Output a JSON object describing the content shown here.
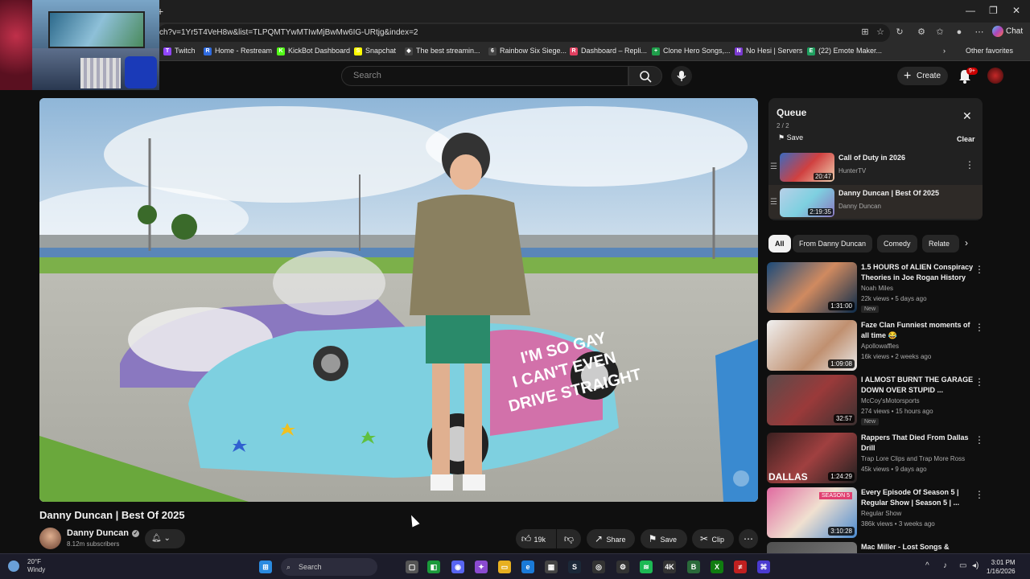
{
  "browser": {
    "url": "ch?v=1Yr5T4VeH8w&list=TLPQMTYwMTIwMjBwMw6IG-URtjg&index=2",
    "chat_label": "Chat",
    "bookmarks": [
      {
        "label": "Twitch",
        "color": "#9146ff",
        "glyph": "T"
      },
      {
        "label": "Home - Restream",
        "color": "#2f6be0",
        "glyph": "R"
      },
      {
        "label": "KickBot Dashboard",
        "color": "#53fc18",
        "glyph": "K"
      },
      {
        "label": "Snapchat",
        "color": "#fffc00",
        "glyph": "S"
      },
      {
        "label": "The best streamin...",
        "color": "#444",
        "glyph": "◆"
      },
      {
        "label": "Rainbow Six Siege...",
        "color": "#444",
        "glyph": "6"
      },
      {
        "label": "Dashboard – Repli...",
        "color": "#e04060",
        "glyph": "R"
      },
      {
        "label": "Clone Hero Songs,...",
        "color": "#1e9e4a",
        "glyph": "+"
      },
      {
        "label": "No Hesi | Servers",
        "color": "#7a3ad0",
        "glyph": "N"
      },
      {
        "label": "(22) Emote Maker...",
        "color": "#20a060",
        "glyph": "E"
      }
    ],
    "other_favorites": "Other favorites"
  },
  "topbar": {
    "search_placeholder": "Search",
    "create_label": "Create",
    "notif_badge": "9+"
  },
  "video": {
    "title": "Danny Duncan | Best Of 2025",
    "channel": "Danny Duncan",
    "subscribers": "8.12m subscribers",
    "likes": "19k",
    "share_label": "Share",
    "save_label": "Save",
    "clip_label": "Clip"
  },
  "queue": {
    "title": "Queue",
    "count": "2 / 2",
    "save_label": "Save",
    "clear_label": "Clear",
    "items": [
      {
        "title": "Call of Duty in 2026",
        "channel": "HunterTV",
        "duration": "20:47"
      },
      {
        "title": "Danny Duncan | Best Of 2025",
        "channel": "Danny Duncan",
        "duration": "2:19:35"
      }
    ]
  },
  "chips": [
    "All",
    "From Danny Duncan",
    "Comedy",
    "Relate"
  ],
  "recommendations": [
    {
      "title1": "1.5 HOURS of ALIEN Conspiracy",
      "title2": "Theories in Joe Rogan History",
      "channel": "Noah Miles",
      "meta": "22k views • 5 days ago",
      "badge": "New",
      "duration": "1:31:00",
      "thumb": "linear-gradient(135deg,#1a4a7a,#d08a60 50%,#0a2a4a)"
    },
    {
      "title1": "Faze Clan Funniest moments of",
      "title2": "all time 😂",
      "channel": "Apollowaffles",
      "meta": "16k views • 2 weeks ago",
      "badge": "",
      "duration": "1:09:08",
      "thumb": "linear-gradient(135deg,#f0f0f0,#c09070 60%,#e8e8e8)"
    },
    {
      "title1": "I ALMOST BURNT THE GARAGE",
      "title2": "DOWN OVER STUPID ...",
      "channel": "McCoy'sMotorsports",
      "meta": "274 views • 15 hours ago",
      "badge": "New",
      "duration": "32:57",
      "thumb": "linear-gradient(135deg,#5a4a4a,#9a3a3a 50%,#3a3030)"
    },
    {
      "title1": "Rappers That Died From Dallas",
      "title2": "Drill",
      "channel": "Trap Lore Clips and Trap More Ross",
      "meta": "45k views • 9 days ago",
      "badge": "",
      "duration": "1:24:29",
      "thumb": "linear-gradient(135deg,#3a2020,#a04040 50%,#202020)"
    },
    {
      "title1": "Every Episode Of Season 5 |",
      "title2": "Regular Show | Season 5 | ...",
      "channel": "Regular Show",
      "meta": "386k views • 3 weeks ago",
      "badge": "",
      "duration": "3:10:28",
      "thumb": "linear-gradient(135deg,#e06aa0,#f0e0d0 50%,#4a8ad0)"
    },
    {
      "title1": "Mac Miller - Lost Songs &",
      "title2": "",
      "channel": "",
      "meta": "",
      "badge": "",
      "duration": "",
      "thumb": "linear-gradient(135deg,#505050,#808080)"
    }
  ],
  "labels": {
    "dallas_overlay": "DALLAS",
    "season_overlay": "SEASON 5",
    "car_text_1": "I'M SO GAY",
    "car_text_2": "I CAN'T EVEN",
    "car_text_3": "DRIVE STRAIGHT"
  },
  "taskbar": {
    "temp": "20°F",
    "condition": "Windy",
    "search_label": "Search",
    "time": "3:01 PM",
    "date": "1/16/2026"
  }
}
